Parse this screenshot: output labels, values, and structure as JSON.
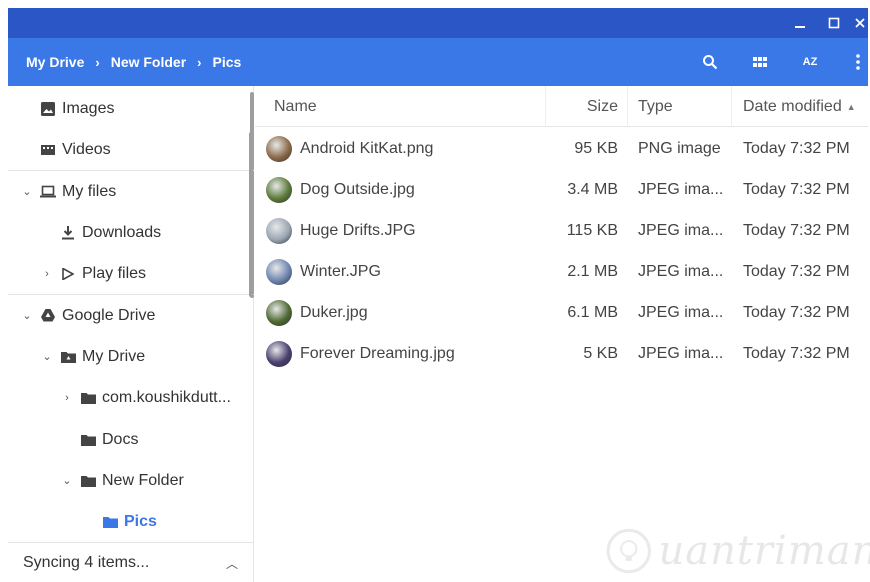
{
  "window": {
    "minimize_icon": "minimize-icon",
    "maximize_icon": "maximize-icon",
    "close_icon": "close-icon"
  },
  "colors": {
    "titlebar": "#2a56c6",
    "header": "#3b78e7",
    "accent": "#3b78e7"
  },
  "breadcrumb": [
    {
      "label": "My Drive"
    },
    {
      "label": "New Folder"
    },
    {
      "label": "Pics"
    }
  ],
  "breadcrumb_separator": "›",
  "toolbar": {
    "search_icon": "search-icon",
    "grid_icon": "grid-view-icon",
    "sort_label": "AZ",
    "more_icon": "more-vert-icon"
  },
  "sidebar": {
    "items": [
      {
        "label": "Images",
        "icon": "image-icon"
      },
      {
        "label": "Videos",
        "icon": "video-icon"
      },
      {
        "label": "My files",
        "icon": "laptop-icon"
      },
      {
        "label": "Downloads",
        "icon": "download-icon"
      },
      {
        "label": "Play files",
        "icon": "play-icon"
      },
      {
        "label": "Google Drive",
        "icon": "drive-icon"
      },
      {
        "label": "My Drive",
        "icon": "shared-folder-icon"
      },
      {
        "label": "com.koushikdutt...",
        "icon": "folder-icon"
      },
      {
        "label": "Docs",
        "icon": "folder-icon"
      },
      {
        "label": "New Folder",
        "icon": "folder-icon"
      },
      {
        "label": "Pics",
        "icon": "folder-icon"
      }
    ],
    "sync_label": "Syncing 4 items..."
  },
  "list": {
    "columns": {
      "name": "Name",
      "size": "Size",
      "type": "Type",
      "date": "Date modified"
    },
    "rows": [
      {
        "name": "Android KitKat.png",
        "size": "95 KB",
        "type": "PNG image",
        "date": "Today 7:32 PM",
        "thumb_color": "#8a6a4a"
      },
      {
        "name": "Dog Outside.jpg",
        "size": "3.4 MB",
        "type": "JPEG ima...",
        "date": "Today 7:32 PM",
        "thumb_color": "#5b7a3a"
      },
      {
        "name": "Huge Drifts.JPG",
        "size": "115 KB",
        "type": "JPEG ima...",
        "date": "Today 7:32 PM",
        "thumb_color": "#9aa6b4"
      },
      {
        "name": "Winter.JPG",
        "size": "2.1 MB",
        "type": "JPEG ima...",
        "date": "Today 7:32 PM",
        "thumb_color": "#6f86b0"
      },
      {
        "name": "Duker.jpg",
        "size": "6.1 MB",
        "type": "JPEG ima...",
        "date": "Today 7:32 PM",
        "thumb_color": "#4e6a32"
      },
      {
        "name": "Forever Dreaming.jpg",
        "size": "5 KB",
        "type": "JPEG ima...",
        "date": "Today 7:32 PM",
        "thumb_color": "#4a4070"
      }
    ]
  }
}
